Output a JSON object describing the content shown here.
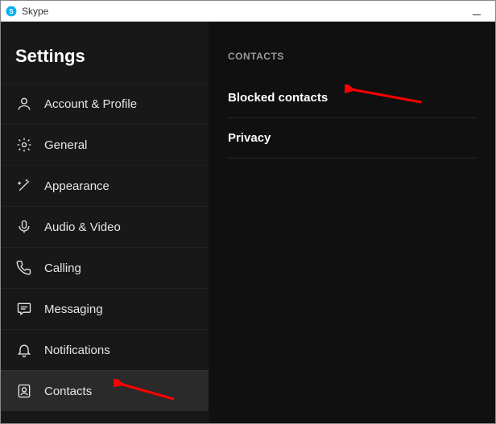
{
  "window": {
    "title": "Skype"
  },
  "sidebar": {
    "heading": "Settings",
    "items": [
      {
        "label": "Account & Profile"
      },
      {
        "label": "General"
      },
      {
        "label": "Appearance"
      },
      {
        "label": "Audio & Video"
      },
      {
        "label": "Calling"
      },
      {
        "label": "Messaging"
      },
      {
        "label": "Notifications"
      },
      {
        "label": "Contacts"
      }
    ]
  },
  "main": {
    "section": "CONTACTS",
    "rows": [
      {
        "label": "Blocked contacts"
      },
      {
        "label": "Privacy"
      }
    ]
  }
}
